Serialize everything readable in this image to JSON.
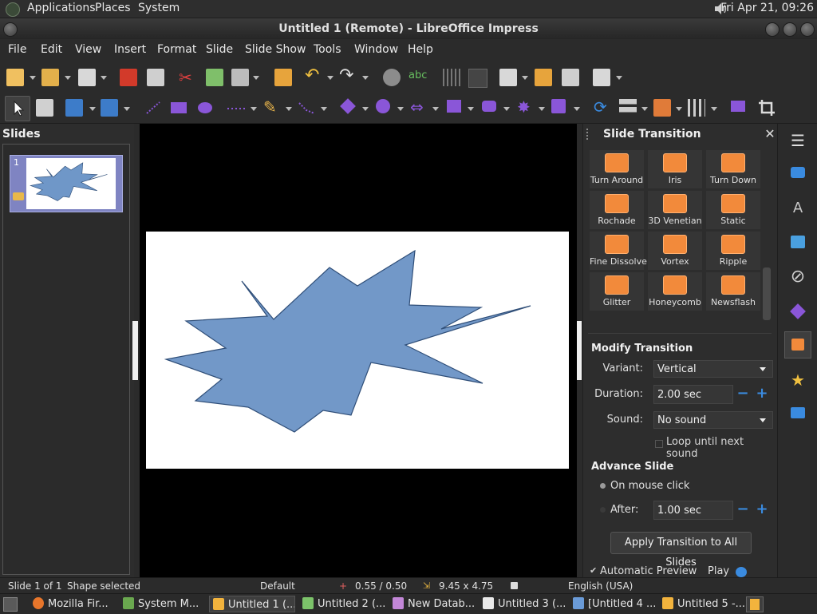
{
  "top_panel": {
    "menus": [
      "Applications",
      "Places",
      "System"
    ],
    "clock": "Fri Apr 21, 09:26"
  },
  "window": {
    "title": "Untitled 1 (Remote) - LibreOffice Impress"
  },
  "menubar": [
    "File",
    "Edit",
    "View",
    "Insert",
    "Format",
    "Slide",
    "Slide Show",
    "Tools",
    "Window",
    "Help"
  ],
  "slides_pane": {
    "title": "Slides",
    "slide_number": "1"
  },
  "sidebar": {
    "title": "Slide Transition",
    "transitions": [
      {
        "label": "Turn Around",
        "icon": "turn-around-icon"
      },
      {
        "label": "Iris",
        "icon": "iris-icon"
      },
      {
        "label": "Turn Down",
        "icon": "turn-down-icon"
      },
      {
        "label": "Rochade",
        "icon": "rochade-icon"
      },
      {
        "label": "3D Venetian",
        "icon": "venetian-icon"
      },
      {
        "label": "Static",
        "icon": "static-icon"
      },
      {
        "label": "Fine Dissolve",
        "icon": "fine-dissolve-icon"
      },
      {
        "label": "Vortex",
        "icon": "vortex-icon"
      },
      {
        "label": "Ripple",
        "icon": "ripple-icon"
      },
      {
        "label": "Glitter",
        "icon": "glitter-icon"
      },
      {
        "label": "Honeycomb",
        "icon": "honeycomb-icon"
      },
      {
        "label": "Newsflash",
        "icon": "newsflash-icon"
      }
    ],
    "modify": {
      "title": "Modify Transition",
      "variant_label": "Variant:",
      "variant_value": "Vertical",
      "duration_label": "Duration:",
      "duration_value": "2.00 sec",
      "sound_label": "Sound:",
      "sound_value": "No sound",
      "loop_label": "Loop until next sound"
    },
    "advance": {
      "title": "Advance Slide",
      "on_click_label": "On mouse click",
      "after_label": "After:",
      "after_value": "1.00 sec"
    },
    "apply_all": "Apply Transition to All Slides",
    "auto_preview": "Automatic Preview",
    "play": "Play"
  },
  "statusbar": {
    "slide_info": "Slide 1 of 1",
    "selection": "Shape selected",
    "master": "Default",
    "position": "0.55 / 0.50",
    "size": "9.45 x 4.75",
    "language": "English (USA)"
  },
  "taskbar": [
    {
      "label": "Mozilla Fir...",
      "color": "#e8762b",
      "active": false
    },
    {
      "label": "System M...",
      "color": "#6aa84f",
      "active": false
    },
    {
      "label": "Untitled 1 (...",
      "color": "#f2b33d",
      "active": true
    },
    {
      "label": "Untitled 2 (...",
      "color": "#7cc36a",
      "active": false
    },
    {
      "label": "New Datab...",
      "color": "#c387d8",
      "active": false
    },
    {
      "label": "Untitled 3 (...",
      "color": "#e9e9e9",
      "active": false
    },
    {
      "label": "[Untitled 4 ...",
      "color": "#6a9bd8",
      "active": false
    },
    {
      "label": "Untitled 5 -...",
      "color": "#f2b33d",
      "active": false
    }
  ]
}
